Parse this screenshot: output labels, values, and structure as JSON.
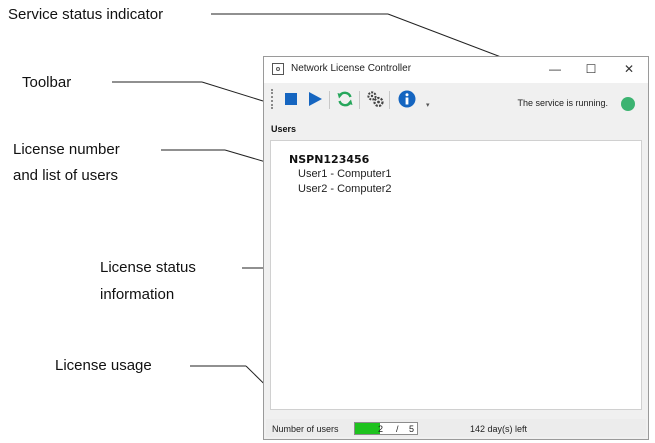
{
  "callouts": {
    "service_status": "Service status indicator",
    "toolbar": "Toolbar",
    "license_list_1": "License number",
    "license_list_2": "and list of users",
    "license_status_1": "License status",
    "license_status_2": "information",
    "license_usage": "License usage"
  },
  "window": {
    "title": "Network License Controller",
    "minimize": "—",
    "maximize": "☐",
    "close": "✕"
  },
  "toolbar": {
    "buttons": [
      "stop-icon",
      "start-icon",
      "refresh-icon",
      "settings-icon",
      "info-icon"
    ],
    "colors": {
      "stop": "#1565c0",
      "start": "#1565c0",
      "refresh": "#26a65b",
      "settings": "#444444",
      "info": "#1565c0"
    }
  },
  "service": {
    "status_text": "The service is running.",
    "indicator_color": "#3cb371"
  },
  "users": {
    "heading": "Users",
    "license_number": "NSPN123456",
    "list": [
      "User1 - Computer1",
      "User2 - Computer2"
    ]
  },
  "statusbar": {
    "users_label": "Number of users",
    "current_users": "2",
    "separator": "/",
    "max_users": "5",
    "usage_fraction": 0.4,
    "days_left": "142 day(s) left"
  }
}
